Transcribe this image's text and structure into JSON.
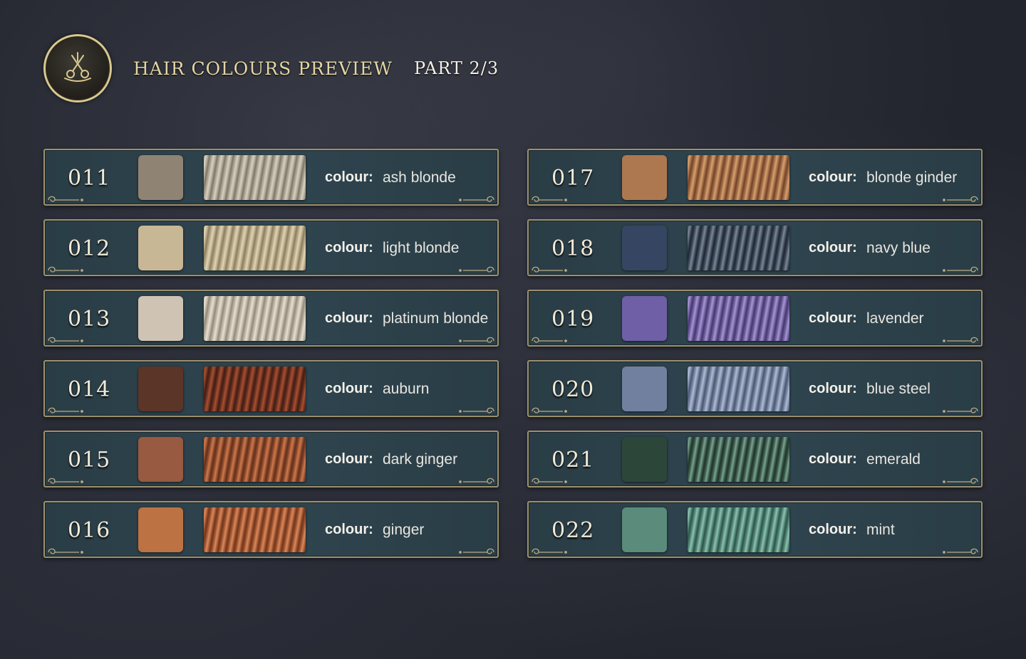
{
  "header": {
    "title": "HAIR COLOURS PREVIEW",
    "part": "PART 2/3",
    "emblem_icon": "scissors-comb-icon"
  },
  "label_text": "colour:",
  "left_column": [
    {
      "id": "011",
      "name": "ash blonde",
      "swatch": "#8f8374",
      "hair": [
        "#aca493",
        "#d7d0bf",
        "#7d7566"
      ]
    },
    {
      "id": "012",
      "name": "light blonde",
      "swatch": "#c8b795",
      "hair": [
        "#b6a785",
        "#e0d4b6",
        "#8a7c5f"
      ]
    },
    {
      "id": "013",
      "name": "platinum blonde",
      "swatch": "#cfc3b3",
      "hair": [
        "#bdb3a3",
        "#e6dfd2",
        "#928978"
      ]
    },
    {
      "id": "014",
      "name": "auburn",
      "swatch": "#5a3528",
      "hair": [
        "#6a3020",
        "#a8502f",
        "#3d1d14"
      ]
    },
    {
      "id": "015",
      "name": "dark ginger",
      "swatch": "#985a40",
      "hair": [
        "#8e4a2c",
        "#cd7a4c",
        "#5e2f1c"
      ]
    },
    {
      "id": "016",
      "name": "ginger",
      "swatch": "#bd7243",
      "hair": [
        "#a0532f",
        "#d98a5c",
        "#6b361d"
      ]
    }
  ],
  "right_column": [
    {
      "id": "017",
      "name": "blonde ginder",
      "swatch": "#ad7850",
      "hair": [
        "#a06a45",
        "#d7a070",
        "#6e4428"
      ]
    },
    {
      "id": "018",
      "name": "navy blue",
      "swatch": "#364561",
      "hair": [
        "#3e4a58",
        "#7b8898",
        "#1e2530"
      ]
    },
    {
      "id": "019",
      "name": "lavender",
      "swatch": "#6f5fa7",
      "hair": [
        "#6e5b9c",
        "#a597d0",
        "#43376b"
      ]
    },
    {
      "id": "020",
      "name": "blue steel",
      "swatch": "#7280a0",
      "hair": [
        "#7482a0",
        "#b0bccf",
        "#4a5670"
      ]
    },
    {
      "id": "021",
      "name": "emerald",
      "swatch": "#2d463a",
      "hair": [
        "#3c5a4c",
        "#7aa390",
        "#1f3229"
      ]
    },
    {
      "id": "022",
      "name": "mint",
      "swatch": "#5b8b7a",
      "hair": [
        "#4f8374",
        "#8ec2b0",
        "#2f5247"
      ]
    }
  ]
}
